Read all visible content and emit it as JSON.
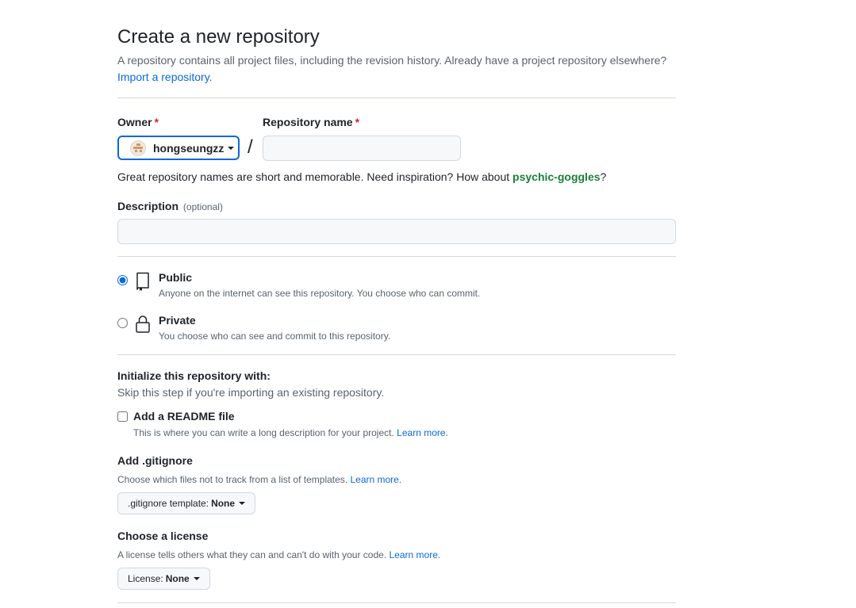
{
  "header": {
    "title": "Create a new repository",
    "subtitle": "A repository contains all project files, including the revision history. Already have a project repository elsewhere?",
    "import_link": "Import a repository."
  },
  "form": {
    "owner_label": "Owner",
    "required_mark": "*",
    "owner_value": "hongseungzz",
    "slash": "/",
    "repo_name_label": "Repository name",
    "repo_name_value": "",
    "hint_text": "Great repository names are short and memorable. Need inspiration? How about ",
    "suggestion": "psychic-goggles",
    "hint_end": "?",
    "description_label": "Description",
    "description_optional": "(optional)",
    "description_value": ""
  },
  "visibility": {
    "selected": "public",
    "public_title": "Public",
    "public_desc": "Anyone on the internet can see this repository. You choose who can commit.",
    "private_title": "Private",
    "private_desc": "You choose who can see and commit to this repository."
  },
  "initialize": {
    "title": "Initialize this repository with:",
    "subtitle": "Skip this step if you're importing an existing repository.",
    "readme_label": "Add a README file",
    "readme_checked": false,
    "readme_desc": "This is where you can write a long description for your project.",
    "learn_more": "Learn more."
  },
  "gitignore": {
    "title": "Add .gitignore",
    "desc": "Choose which files not to track from a list of templates.",
    "learn_more": "Learn more.",
    "button_prefix": ".gitignore template:",
    "button_value": "None"
  },
  "license": {
    "title": "Choose a license",
    "desc": "A license tells others what they can and can't do with your code.",
    "learn_more": "Learn more.",
    "button_prefix": "License:",
    "button_value": "None"
  },
  "colors": {
    "accent": "#0969da",
    "required": "#d1242f",
    "suggestion": "#1a7f37"
  }
}
